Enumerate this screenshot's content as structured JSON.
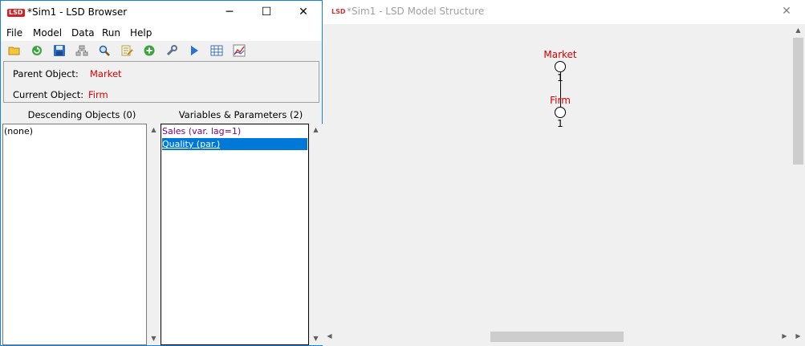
{
  "browser": {
    "logo": "LSD",
    "title": "*Sim1 - LSD Browser",
    "window_controls": {
      "minimize": "─",
      "maximize": "☐",
      "close": "✕"
    },
    "menu": [
      "File",
      "Model",
      "Data",
      "Run",
      "Help"
    ],
    "toolbar_icons": [
      "open-folder-icon",
      "reload-icon",
      "save-icon",
      "network-icon",
      "find-icon",
      "edit-notes-icon",
      "add-icon",
      "settings-wrench-icon",
      "run-icon",
      "data-grid-icon",
      "analysis-chart-icon"
    ],
    "parent_label": "Parent Object:",
    "parent_value": "Market",
    "current_label": "Current Object:",
    "current_value": "Firm",
    "descending_header": "Descending Objects (0)",
    "variables_header": "Variables & Parameters (2)",
    "descending_items": [
      "(none)"
    ],
    "variable_items": [
      {
        "label": "Sales (var. lag=1)",
        "color": "#800080",
        "selected": false
      },
      {
        "label": "Quality (par.)",
        "color": "#ffffff",
        "selected": true
      }
    ],
    "accent": "#1883d7",
    "selection": "#0078d7"
  },
  "model": {
    "logo": "LSD",
    "title": "*Sim1 - LSD Model Structure",
    "close": "✕",
    "nodes": [
      {
        "name": "Market",
        "count": "1"
      },
      {
        "name": "Firm",
        "count": "1"
      }
    ],
    "node_label_color": "#d40000"
  }
}
